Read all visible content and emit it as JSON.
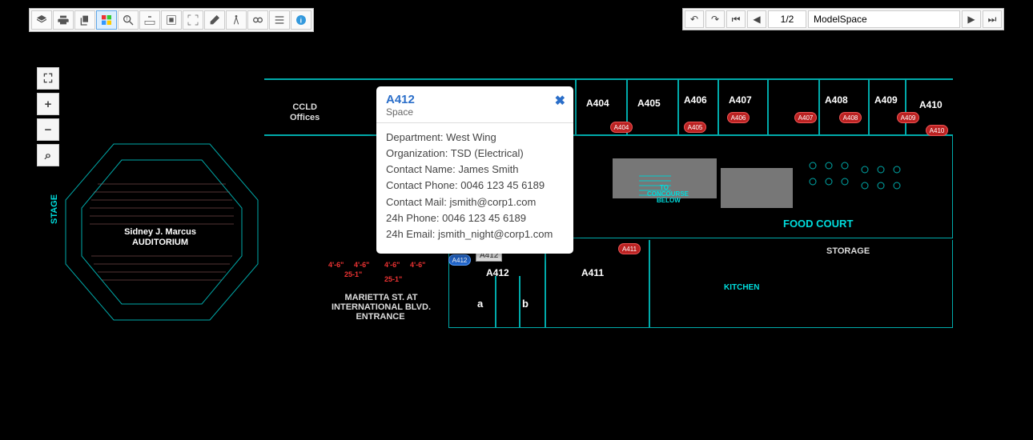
{
  "toolbar": {
    "buttons": [
      {
        "name": "layers-icon"
      },
      {
        "name": "print-icon"
      },
      {
        "name": "copy-icon"
      },
      {
        "name": "multiview-icon",
        "selected": true
      },
      {
        "name": "zoom-text-icon"
      },
      {
        "name": "zoom-out-icon"
      },
      {
        "name": "extents-icon"
      },
      {
        "name": "fit-icon"
      },
      {
        "name": "eraser-icon"
      },
      {
        "name": "compass-icon"
      },
      {
        "name": "link-icon"
      },
      {
        "name": "list-icon"
      },
      {
        "name": "info-icon"
      }
    ]
  },
  "nav": {
    "page_field": "1/2",
    "model_field": "ModelSpace"
  },
  "zoom": {
    "fullscreen": "⛶",
    "plus": "+",
    "minus": "−",
    "reset": "⌕"
  },
  "popup": {
    "title": "A412",
    "subtitle": "Space",
    "rows": [
      "Department: West Wing",
      "Organization: TSD (Electrical)",
      "Contact Name: James Smith",
      "Contact Phone: 0046 123 45 6189",
      "Contact Mail: jsmith@corp1.com",
      "24h Phone: 0046 123 45 6189",
      "24h Email: jsmith_night@corp1.com"
    ]
  },
  "labels": {
    "ccld": "CCLD\nOffices",
    "auditorium1": "Sidney J. Marcus",
    "auditorium2": "AUDITORIUM",
    "stage": "STAGE",
    "entrance1": "MARIETTA ST. AT",
    "entrance2": "INTERNATIONAL BLVD.",
    "entrance3": "ENTRANCE",
    "foodcourt": "FOOD COURT",
    "storage": "STORAGE",
    "kitchen": "KITCHEN",
    "concourse1": "TO",
    "concourse2": "CONCOURSE",
    "concourse3": "BELOW",
    "a412tag": "A412",
    "a": "a",
    "b": "b",
    "rooms": {
      "A404": "A404",
      "A405": "A405",
      "A406": "A406",
      "A407": "A407",
      "A408": "A408",
      "A409": "A409",
      "A410": "A410",
      "A411": "A411",
      "A412": "A412"
    }
  },
  "markers": [
    "A404",
    "A405",
    "A406",
    "A407",
    "A408",
    "A409",
    "A410",
    "A411",
    "A412"
  ]
}
